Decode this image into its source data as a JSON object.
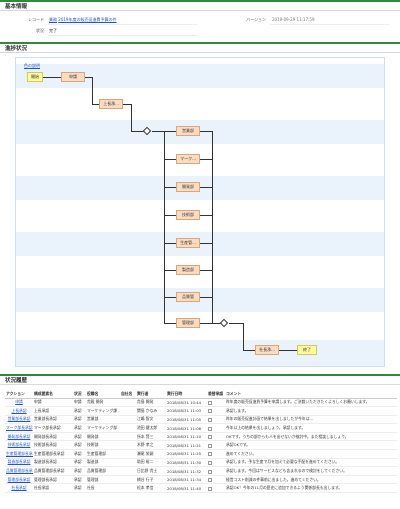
{
  "basic_info": {
    "title": "基本情報",
    "record_label": "レコード",
    "record_prefix": "業務",
    "record_link": "2019年度の販売促進費予算の件",
    "version_label": "バージョン",
    "version_value": "2019-09-29 11:17:59",
    "status_label": "状況",
    "status_value": "完了"
  },
  "progress": {
    "title": "進捗状況",
    "legend": "色の説明",
    "nodes": {
      "start": "開始",
      "apply": "申請",
      "boss": "上長承...",
      "sales": "営業部",
      "marketing": "マーク...",
      "development": "開発部",
      "tech": "技術部",
      "production": "生産管...",
      "manufacturing": "製造部",
      "quality": "品質管",
      "management": "管理部",
      "president": "社長承...",
      "end": "終了"
    }
  },
  "history": {
    "title": "状況履歴",
    "columns": [
      "アクション",
      "構成要素名",
      "状況",
      "役職名",
      "自社名",
      "実行者",
      "実行日時",
      "差替承認",
      "コメント"
    ],
    "rows": [
      {
        "action": "申請",
        "element": "申請",
        "status": "申請",
        "role": "貴殿 開発",
        "company": "",
        "user": "貴島 開発",
        "datetime": "2018/08/31 10:44",
        "comment": "昨年度の販売促進費予算を申請します。ご決裁いただきたくよろしくお願いします。"
      },
      {
        "action": "上長承認",
        "element": "上長承認",
        "status": "承認",
        "role": "マーケティング課",
        "company": "",
        "user": "関島 かなみ",
        "datetime": "2018/08/31 11:03",
        "comment": "承認します。"
      },
      {
        "action": "営業部長承認",
        "element": "営業部長承認",
        "status": "承認",
        "role": "営業部",
        "company": "",
        "user": "江嶋 智文",
        "datetime": "2018/08/31 11:05",
        "comment": "昨年の販売促進計画で結果を出しましたが今年は..."
      },
      {
        "action": "マーク部長承認",
        "element": "マーク部長承認",
        "status": "承認",
        "role": "マーケティング部",
        "company": "",
        "user": "池田 健太郎",
        "datetime": "2018/08/31 11:08",
        "comment": "今年以上の結果を出しましょう。承認します。"
      },
      {
        "action": "開発部長承認",
        "element": "開発部長承認",
        "status": "承認",
        "role": "開発部",
        "company": "",
        "user": "所本 賢三",
        "datetime": "2018/08/31 11:10",
        "comment": "OKです。うちの部からも人を出せないか検討中。また相談しましょう。"
      },
      {
        "action": "技術部長承認",
        "element": "技術部長承認",
        "status": "承認",
        "role": "技術部",
        "company": "",
        "user": "木野 孝之",
        "datetime": "2018/08/31 11:21",
        "comment": "承認OKです。"
      },
      {
        "action": "生産管理部長承認",
        "element": "生産管理部長承認",
        "status": "承認",
        "role": "生産管理部",
        "company": "",
        "user": "瀬尾 栄嗣",
        "datetime": "2018/08/31 11:25",
        "comment": "進めてください。"
      },
      {
        "action": "製造部長承認",
        "element": "製造部長承認",
        "status": "承認",
        "role": "製造部",
        "company": "",
        "user": "助田 裕二",
        "datetime": "2018/08/31 11:30",
        "comment": "承認します。予な生産で月を加えて必要な手配を進めてください。"
      },
      {
        "action": "品質管理部長承認",
        "element": "品質管理部長承認",
        "status": "承認",
        "role": "品質管理部",
        "company": "",
        "user": "日比野 貴士",
        "datetime": "2018/08/31 11:32",
        "comment": "承認します。今回はサービスなども含まれるので検討をしてください。"
      },
      {
        "action": "管理部長承認",
        "element": "管理部長承認",
        "status": "承認",
        "role": "管理部",
        "company": "",
        "user": "橋谷 行子",
        "datetime": "2018/08/31 11:34",
        "comment": "経営コスト削減の件事前に出ました。進めてください。"
      },
      {
        "action": "社長承認",
        "element": "社長承認",
        "status": "承認",
        "role": "社長",
        "company": "",
        "user": "松本 孝信",
        "datetime": "2018/08/31 11:40",
        "comment": "承認OK！今年の11月の歴史に追加できるよう関係部長も出します。"
      }
    ]
  }
}
